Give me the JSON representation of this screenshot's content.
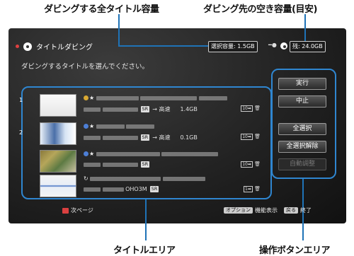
{
  "callouts": {
    "total_capacity": "ダビングする全タイトル容量",
    "free_capacity": "ダビング先の空き容量(目安)",
    "title_area": "タイトルエリア",
    "button_area": "操作ボタンエリア"
  },
  "header": {
    "title": "タイトルダビング",
    "instruction": "ダビングするタイトルを選んでください。",
    "selected_capacity": "選択容量:  1.5GB",
    "remaining_capacity": "残: 24.0GB"
  },
  "titles": [
    {
      "number": "1",
      "quality": "SR",
      "mode": "→ 高速",
      "size": "1.4GB"
    },
    {
      "number": "2",
      "quality": "SR",
      "mode": "→ 高速",
      "size": "0.1GB"
    },
    {
      "number": "",
      "quality": "SR",
      "mode": "",
      "size": ""
    },
    {
      "number": "",
      "quality": "SR",
      "mode": "",
      "size": "",
      "channel": "OHO3M"
    }
  ],
  "buttons": {
    "execute": "実行",
    "stop": "中止",
    "select_all": "全選択",
    "deselect_all": "全選択解除",
    "auto_adjust": "自動調整"
  },
  "footer": {
    "next_page": "次ページ",
    "option_key": "オプション",
    "option_label": "機能表示",
    "back_key": "戻る",
    "back_label": "終了"
  }
}
